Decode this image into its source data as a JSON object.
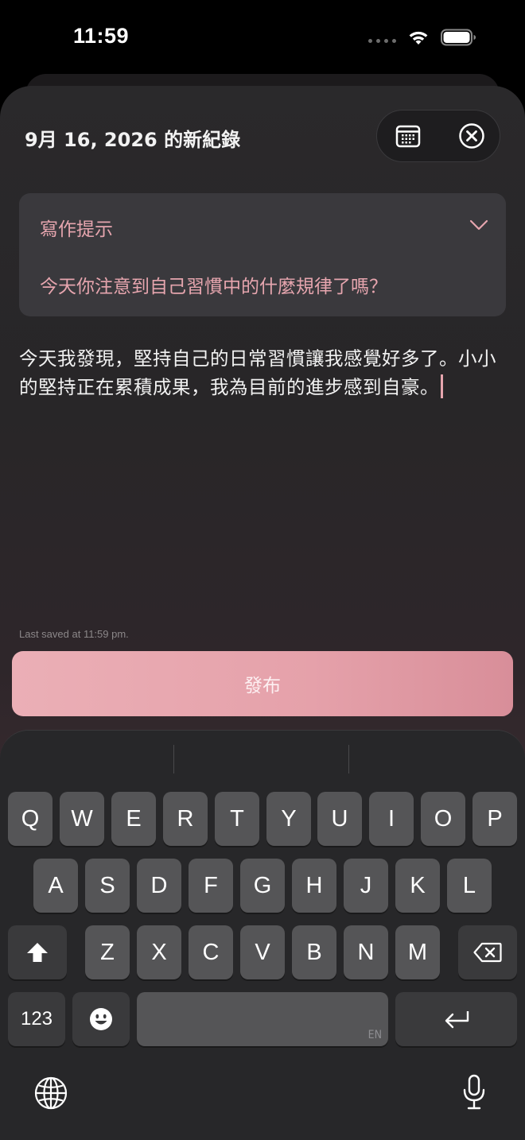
{
  "status": {
    "time": "11:59"
  },
  "header": {
    "title": "9月 16, 2026 的新紀錄"
  },
  "prompt": {
    "title": "寫作提示",
    "question": "今天你注意到自己習慣中的什麼規律了嗎？"
  },
  "entry": {
    "text": "今天我發現，堅持自己的日常習慣讓我感覺好多了。小小的堅持正在累積成果，我為目前的進步感到自豪。"
  },
  "last_saved": "Last saved at 11:59 pm.",
  "publish_label": "發布",
  "keyboard": {
    "row1": [
      "Q",
      "W",
      "E",
      "R",
      "T",
      "Y",
      "U",
      "I",
      "O",
      "P"
    ],
    "row2": [
      "A",
      "S",
      "D",
      "F",
      "G",
      "H",
      "J",
      "K",
      "L"
    ],
    "row3": [
      "Z",
      "X",
      "C",
      "V",
      "B",
      "N",
      "M"
    ],
    "numbers_label": "123",
    "space_lang": "EN"
  },
  "colors": {
    "accent": "#e6a5ae",
    "button": "#e5a1aa"
  }
}
